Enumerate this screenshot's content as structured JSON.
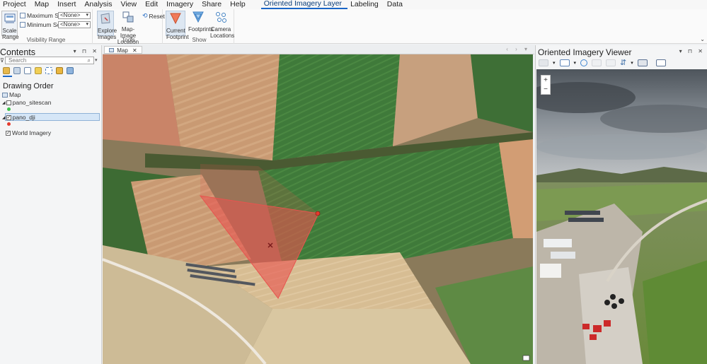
{
  "menu": {
    "items": [
      "Project",
      "Map",
      "Insert",
      "Analysis",
      "View",
      "Edit",
      "Imagery",
      "Share",
      "Help",
      "Oriented Imagery Layer",
      "Labeling",
      "Data"
    ],
    "active_index": 9
  },
  "ribbon": {
    "scale_range_label": "Scale Range",
    "maximum_scale_label": "Maximum Scale",
    "minimum_scale_label": "Minimum Scale",
    "maximum_scale_value": "<None>",
    "minimum_scale_value": "<None>",
    "visibility_range_group": "Visibility Range",
    "explore_images_label": "Explore Images",
    "map_image_location_label": "Map-Image Location",
    "reset_label": "Reset",
    "tools_group": "Tools",
    "current_footprint_label": "Current Footprint",
    "footprints_label": "Footprints",
    "camera_locations_label": "Camera Locations",
    "show_group": "Show"
  },
  "contents": {
    "title": "Contents",
    "search_placeholder": "Search",
    "drawing_order_label": "Drawing Order",
    "layers": {
      "map": "Map",
      "pano_sitescan": "pano_sitescan",
      "pano_dji": "pano_dji",
      "world_imagery": "World Imagery"
    }
  },
  "map_view": {
    "tab_label": "Map"
  },
  "viewer": {
    "title": "Oriented Imagery Viewer",
    "zoom_in": "+",
    "zoom_out": "−"
  },
  "colors": {
    "accent": "#1a66c7",
    "footprint": "#e8544f",
    "sitescan_dot": "#3cc24a",
    "dji_dot": "#e53b2e"
  }
}
